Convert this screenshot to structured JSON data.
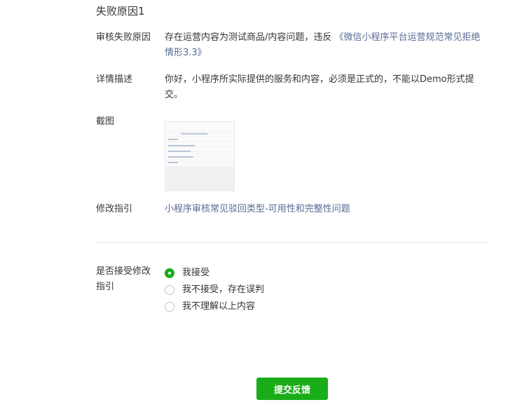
{
  "section_title": "失败原因1",
  "reason": {
    "label": "审核失败原因",
    "text": "存在运营内容为测试商品/内容问题，违反",
    "link": "《微信小程序平台运营规范常见拒绝情形3.3》"
  },
  "detail": {
    "label": "详情描述",
    "text": "你好，小程序所实际提供的服务和内容，必须是正式的，不能以Demo形式提交。"
  },
  "screenshot": {
    "label": "截图"
  },
  "guide": {
    "label": "修改指引",
    "link": "小程序审核常见驳回类型-可用性和完整性问题"
  },
  "accept": {
    "label": "是否接受修改指引",
    "options": [
      {
        "label": "我接受",
        "checked": true
      },
      {
        "label": "我不接受，存在误判",
        "checked": false
      },
      {
        "label": "我不理解以上内容",
        "checked": false
      }
    ]
  },
  "submit_label": "提交反馈",
  "colors": {
    "accent": "#1aad19",
    "link": "#576b95"
  }
}
